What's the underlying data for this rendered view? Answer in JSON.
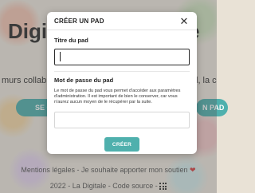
{
  "background": {
    "title_left": "Digit",
    "title_right": "e",
    "subtitle_left": "murs collab",
    "subtitle_right": "l, la c",
    "button_left": "SE CO",
    "button_right": "N PAD",
    "footer_links": "Mentions légales - Je souhaite apporter mon soutien",
    "footer_credit": "2022 - La Digitale - Code source -"
  },
  "modal": {
    "title": "CRÉER UN PAD",
    "title_field_label": "Titre du pad",
    "title_field_value": "",
    "password_field_label": "Mot de passe du pad",
    "password_help": "Le mot de passe du pad vous permet d'accéder aux paramètres d'administration. Il est important de bien le conserver, car vous n'aurez aucun moyen de le récupérer par la suite.",
    "password_field_value": "",
    "submit_label": "CRÉER"
  },
  "icons": {
    "close": "close-icon",
    "heart": "heart-icon",
    "grid": "grid-icon"
  },
  "colors": {
    "accent": "#4fb0ad",
    "heart": "#d84040"
  }
}
